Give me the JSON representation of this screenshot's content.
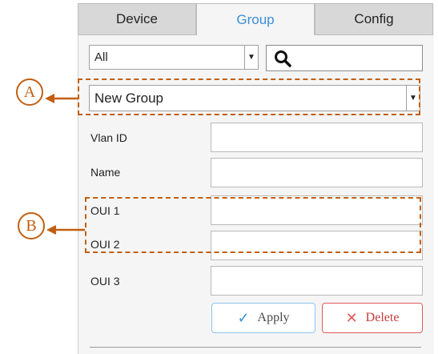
{
  "tabs": [
    "Device",
    "Group",
    "Config"
  ],
  "filter_select": {
    "value": "All"
  },
  "group_select": {
    "value": "New Group"
  },
  "fields": [
    "Vlan ID",
    "Name",
    "OUI 1",
    "OUI 2",
    "OUI 3"
  ],
  "buttons": {
    "apply": "Apply",
    "delete": "Delete"
  },
  "callouts": {
    "a": "A",
    "b": "B"
  },
  "colors": {
    "accent": "#3a8fd8",
    "annotation": "#c25f12",
    "delete": "#e05a5a"
  }
}
